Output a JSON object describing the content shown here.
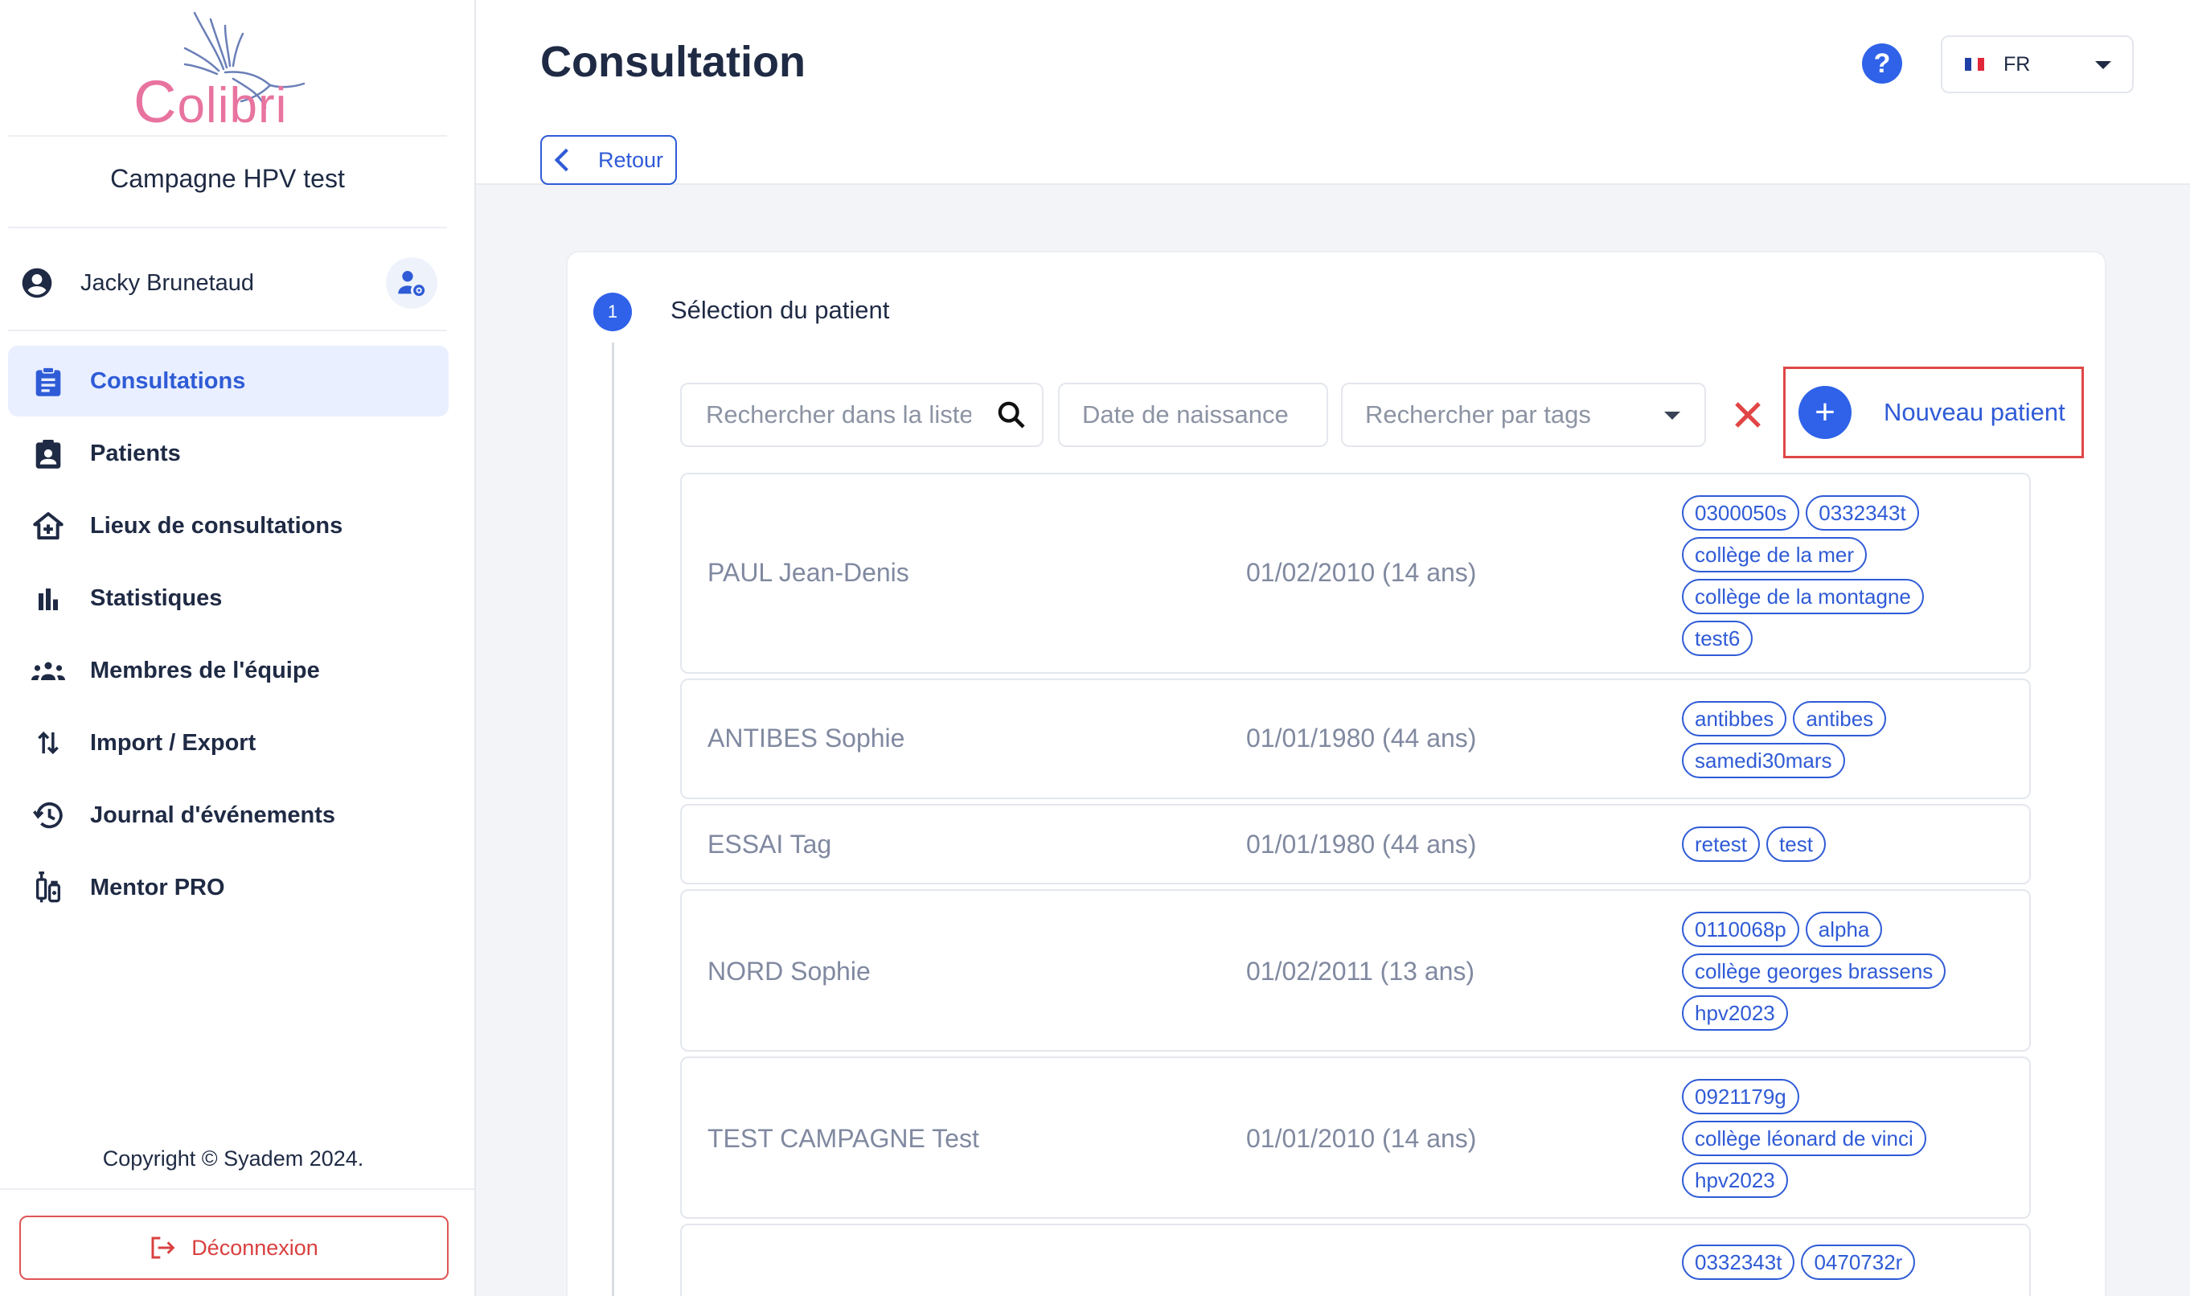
{
  "brand": {
    "name": "Colibri"
  },
  "sidebar": {
    "campaign": "Campagne HPV test",
    "user_name": "Jacky Brunetaud",
    "nav": [
      {
        "label": "Consultations",
        "icon": "clipboard-icon",
        "active": true
      },
      {
        "label": "Patients",
        "icon": "patient-badge-icon",
        "active": false
      },
      {
        "label": "Lieux de consultations",
        "icon": "home-plus-icon",
        "active": false
      },
      {
        "label": "Statistiques",
        "icon": "bar-chart-icon",
        "active": false
      },
      {
        "label": "Membres de l'équipe",
        "icon": "team-icon",
        "active": false
      },
      {
        "label": "Import / Export",
        "icon": "swap-vertical-icon",
        "active": false
      },
      {
        "label": "Journal d'événements",
        "icon": "history-icon",
        "active": false
      },
      {
        "label": "Mentor PRO",
        "icon": "vaccine-icon",
        "active": false
      }
    ],
    "copyright": "Copyright © Syadem 2024.",
    "logout_label": "Déconnexion"
  },
  "header": {
    "title": "Consultation",
    "help_label": "?",
    "language": "FR",
    "back_label": "Retour"
  },
  "step": {
    "number": "1",
    "title": "Sélection du patient"
  },
  "filters": {
    "search_placeholder": "Rechercher dans la liste",
    "dob_placeholder": "Date de naissance",
    "tags_placeholder": "Rechercher par tags",
    "new_patient_label": "Nouveau patient"
  },
  "patients": [
    {
      "name": "PAUL Jean-Denis",
      "dob": "01/02/2010 (14 ans)",
      "tags": [
        "0300050s",
        "0332343t",
        "collège de la mer",
        "collège de la montagne",
        "test6"
      ]
    },
    {
      "name": "ANTIBES Sophie",
      "dob": "01/01/1980 (44 ans)",
      "tags": [
        "antibbes",
        "antibes",
        "samedi30mars"
      ]
    },
    {
      "name": "ESSAI Tag",
      "dob": "01/01/1980 (44 ans)",
      "tags": [
        "retest",
        "test"
      ]
    },
    {
      "name": "NORD Sophie",
      "dob": "01/02/2011 (13 ans)",
      "tags": [
        "0110068p",
        "alpha",
        "collège georges brassens",
        "hpv2023"
      ]
    },
    {
      "name": "TEST CAMPAGNE Test",
      "dob": "01/01/2010 (14 ans)",
      "tags": [
        "0921179g",
        "collège léonard de vinci",
        "hpv2023"
      ]
    },
    {
      "name": "",
      "dob": "",
      "tags": [
        "0332343t",
        "0470732r"
      ]
    }
  ],
  "colors": {
    "accent": "#2f5bd6",
    "danger": "#e04646",
    "brand_pink": "#e8739f"
  }
}
